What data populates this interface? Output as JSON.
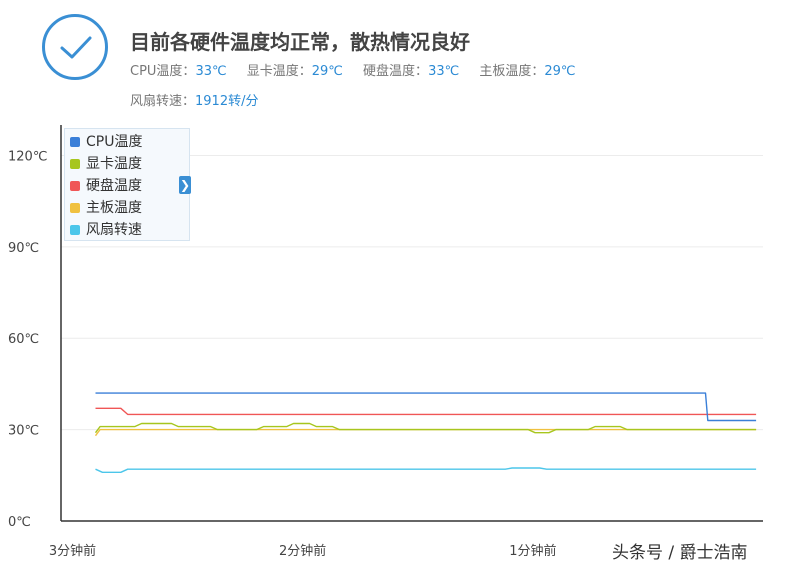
{
  "status": {
    "title": "目前各硬件温度均正常，散热情况良好",
    "temps": [
      {
        "label": "CPU温度：",
        "value": "33℃"
      },
      {
        "label": "显卡温度：",
        "value": "29℃"
      },
      {
        "label": "硬盘温度：",
        "value": "33℃"
      },
      {
        "label": "主板温度：",
        "value": "29℃"
      }
    ],
    "fan": {
      "label": "风扇转速：",
      "value": "1912转/分"
    },
    "icon": "checkmark-circle-icon"
  },
  "colors": {
    "accent": "#3a8fd4",
    "cpu": "#3a7fd8",
    "gpu": "#a7c61e",
    "disk": "#f05656",
    "board": "#f0c140",
    "fan": "#4cc6ea"
  },
  "chart_data": {
    "type": "line",
    "ylim": [
      0,
      130
    ],
    "y_ticks": [
      0,
      30,
      60,
      90,
      120
    ],
    "y_tick_labels": [
      "0℃",
      "30℃",
      "60℃",
      "90℃",
      "120℃"
    ],
    "xlim": [
      -3.05,
      0
    ],
    "x_ticks": [
      -3,
      -2,
      -1
    ],
    "x_tick_labels": [
      "3分钟前",
      "2分钟前",
      "1分钟前"
    ],
    "grid": true,
    "legend_position": "top-left",
    "series": [
      {
        "name": "CPU温度",
        "color": "#3a7fd8",
        "x": [
          -2.9,
          -0.25,
          -0.24,
          -0.03
        ],
        "y": [
          42,
          42,
          33,
          33
        ]
      },
      {
        "name": "显卡温度",
        "color": "#a7c61e",
        "x": [
          -2.9,
          -2.88,
          -2.84,
          -2.73,
          -2.7,
          -2.57,
          -2.54,
          -2.4,
          -2.37,
          -2.2,
          -2.17,
          -2.07,
          -2.04,
          -1.97,
          -1.94,
          -1.87,
          -1.84,
          -1.02,
          -0.99,
          -0.93,
          -0.9,
          -0.76,
          -0.73,
          -0.62,
          -0.59,
          -0.03
        ],
        "y": [
          29,
          31,
          31,
          31,
          32,
          32,
          31,
          31,
          30,
          30,
          31,
          31,
          32,
          32,
          31,
          31,
          30,
          30,
          29,
          29,
          30,
          30,
          31,
          31,
          30,
          30
        ]
      },
      {
        "name": "硬盘温度",
        "color": "#f05656",
        "x": [
          -2.9,
          -2.79,
          -2.76,
          -0.03
        ],
        "y": [
          37,
          37,
          35,
          35
        ]
      },
      {
        "name": "主板温度",
        "color": "#f0c140",
        "x": [
          -2.9,
          -2.88,
          -0.03
        ],
        "y": [
          28,
          30,
          30
        ]
      },
      {
        "name": "风扇转速",
        "color": "#4cc6ea",
        "x": [
          -2.9,
          -2.87,
          -2.79,
          -2.76,
          -1.12,
          -1.09,
          -0.97,
          -0.94,
          -0.03
        ],
        "y": [
          17,
          16,
          16,
          17,
          17,
          17.4,
          17.4,
          17,
          17
        ]
      }
    ]
  },
  "watermark": "头条号 / 爵士浩南"
}
